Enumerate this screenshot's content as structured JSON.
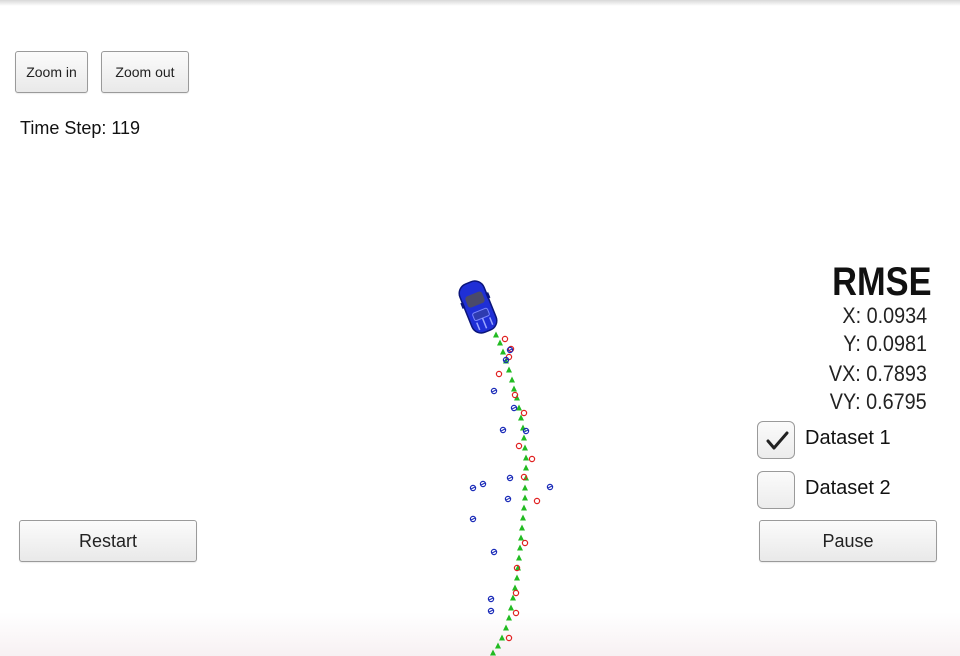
{
  "toolbar": {
    "zoom_in_label": "Zoom in",
    "zoom_out_label": "Zoom out"
  },
  "status": {
    "time_step": "Time Step: 119"
  },
  "rmse": {
    "title": "RMSE",
    "x": "X: 0.0934",
    "y": "Y: 0.0981",
    "vx": "VX: 0.7893",
    "vy": "VY: 0.6795"
  },
  "datasets": [
    {
      "label": "Dataset 1",
      "checked": true
    },
    {
      "label": "Dataset 2",
      "checked": false
    }
  ],
  "controls": {
    "restart_label": "Restart",
    "pause_label": "Pause"
  },
  "colors": {
    "car": "#1f2fd6",
    "estimate_marker": "#22bb22",
    "lidar_marker": "#e02020",
    "radar_marker": "#1a2bb8"
  }
}
